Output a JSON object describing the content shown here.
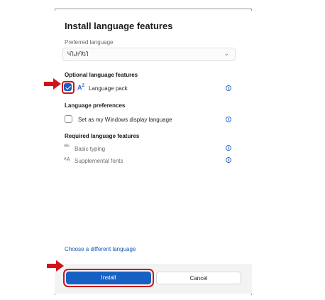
{
  "dialog": {
    "title": "Install language features",
    "preferred_language_label": "Preferred language",
    "preferred_language_value": "ႷႨႰႤႩႨ",
    "optional_section": "Optional language features",
    "language_pack_label": "Language pack",
    "language_pack_checked": true,
    "preferences_section": "Language preferences",
    "display_language_label": "Set as my Windows display language",
    "display_language_checked": false,
    "required_section": "Required language features",
    "basic_typing_label": "Basic typing",
    "supplemental_fonts_label": "Supplemental fonts",
    "choose_link": "Choose a different language",
    "install_button": "Install",
    "cancel_button": "Cancel"
  },
  "icons": {
    "dropdown": "chevron-down-icon",
    "info": "info-icon",
    "language_pack": "language-pack-icon",
    "basic_typing": "abc-typing-icon",
    "fonts": "font-icon",
    "annotation_arrow": "red-arrow-icon"
  },
  "colors": {
    "accent": "#1661c3",
    "annotation_red": "#d0131b"
  }
}
